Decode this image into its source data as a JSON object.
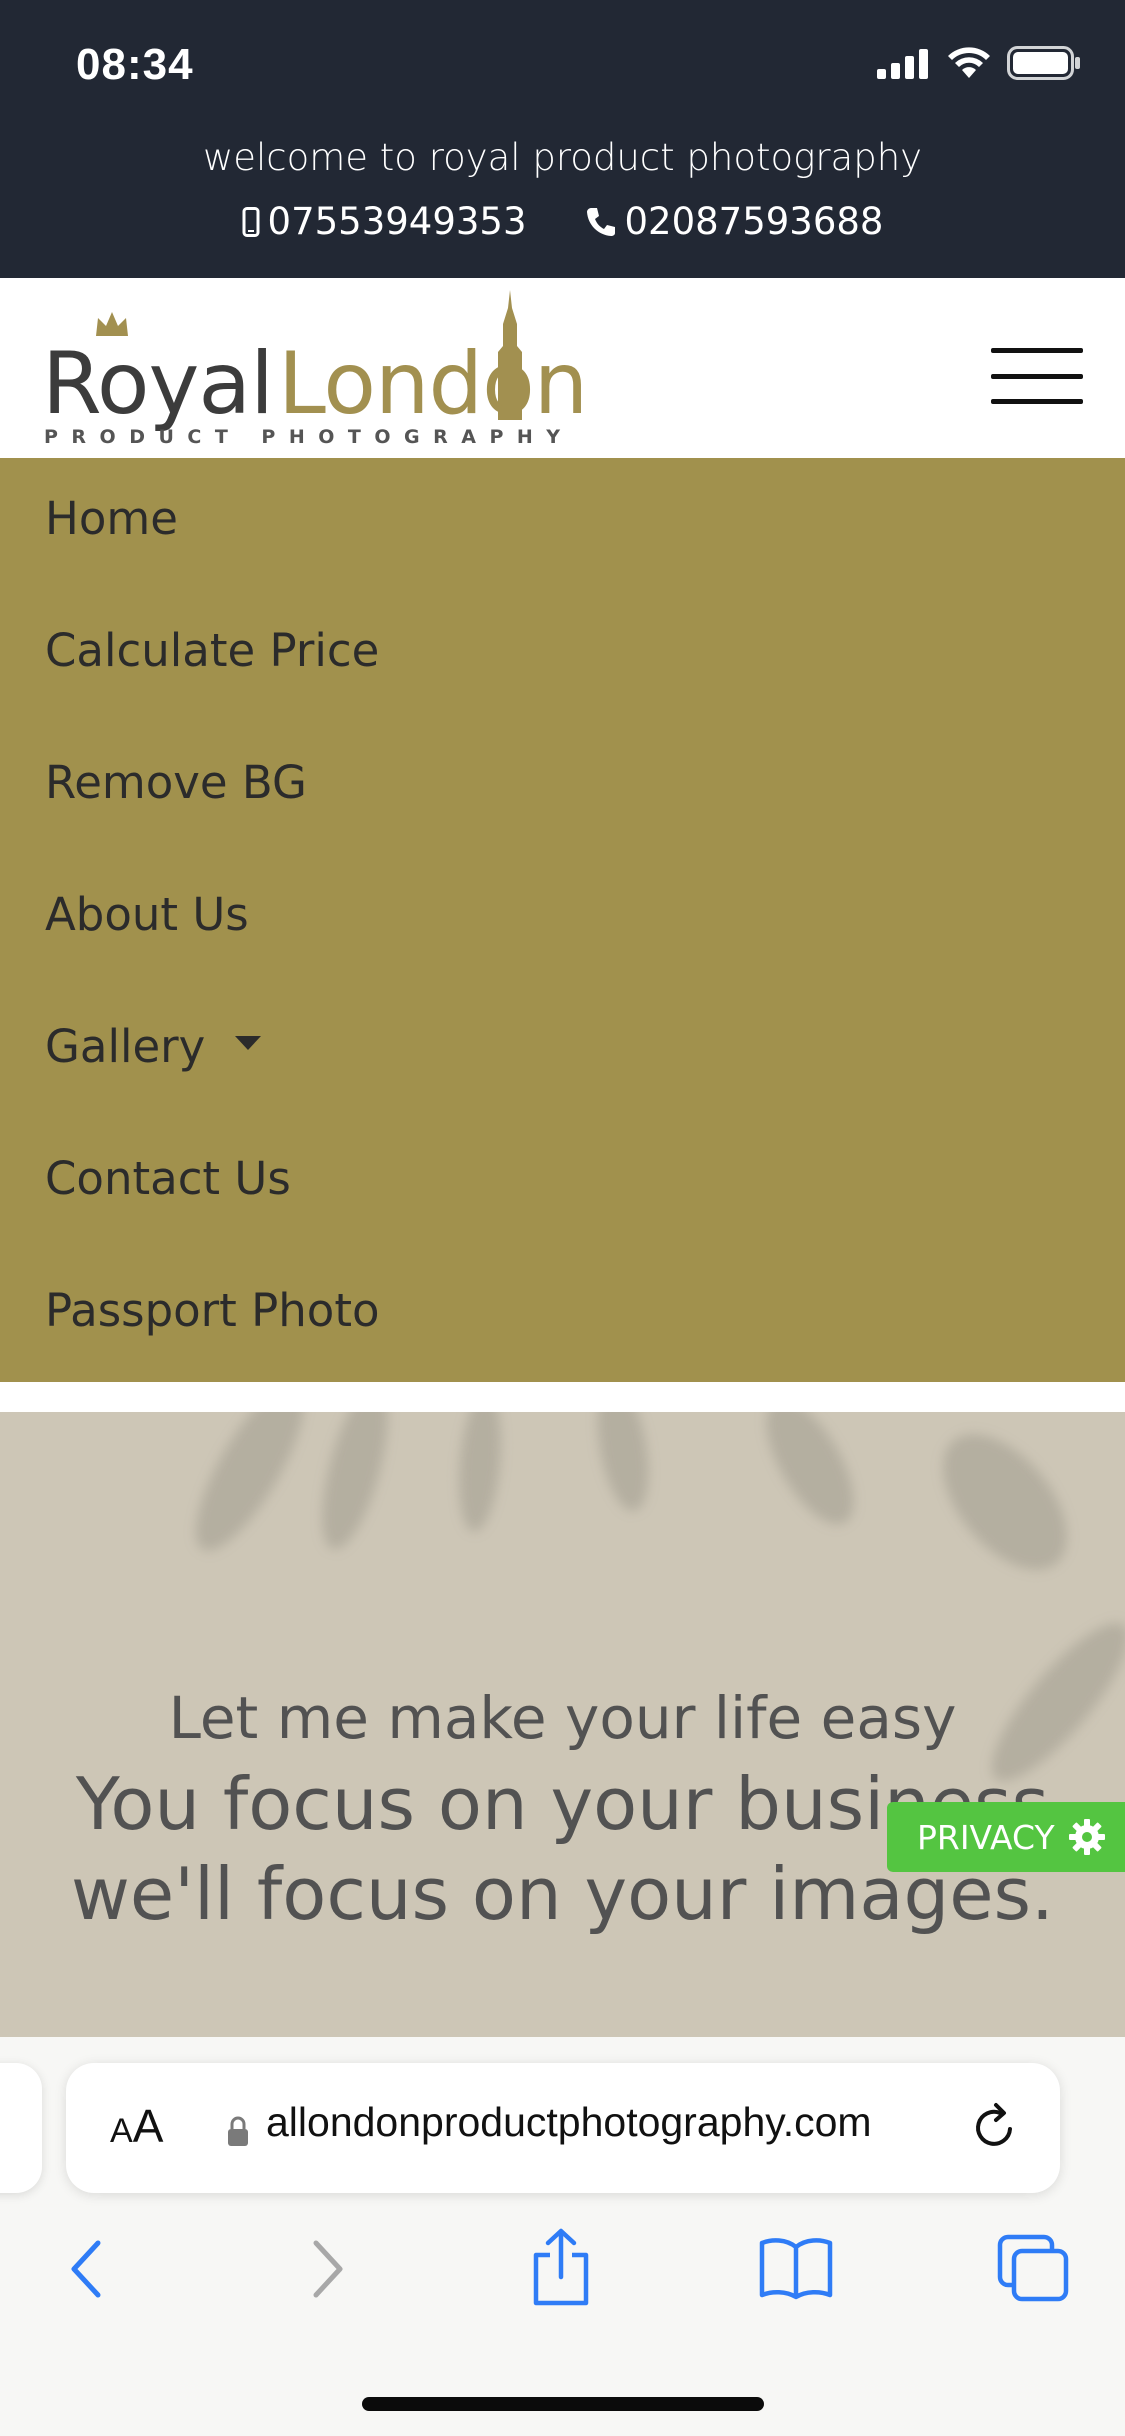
{
  "status_bar": {
    "time": "08:34",
    "signal_icon": "cellular-signal-icon",
    "wifi_icon": "wifi-icon",
    "battery_icon": "battery-icon"
  },
  "header": {
    "welcome": "welcome to royal product photography",
    "mobile": "07553949353",
    "landline": "02087593688"
  },
  "logo": {
    "royal": "Royal",
    "london": "London",
    "tagline": "PRODUCT PHOTOGRAPHY"
  },
  "nav": {
    "items": [
      {
        "label": "Home"
      },
      {
        "label": "Calculate Price"
      },
      {
        "label": "Remove BG"
      },
      {
        "label": "About Us"
      },
      {
        "label": "Gallery"
      },
      {
        "label": "Contact Us"
      },
      {
        "label": "Passport Photo"
      }
    ]
  },
  "hero": {
    "line1": "Let me make your life easy",
    "line2": "You focus on your business",
    "line3": "we'll focus on your images."
  },
  "privacy": {
    "label": "PRIVACY"
  },
  "browser": {
    "aa_label_small": "A",
    "aa_label_big": "A",
    "url": "allondonproductphotography.com"
  },
  "colors": {
    "header_bg": "#222834",
    "nav_bg": "#a1914d",
    "accent_gold": "#a29050",
    "privacy_green": "#54c541",
    "ios_blue": "#2f7cf6"
  }
}
